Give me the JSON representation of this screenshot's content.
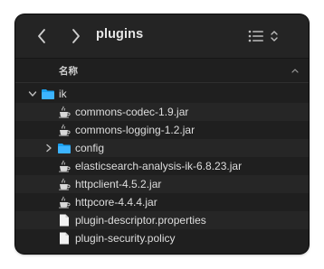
{
  "window": {
    "title": "plugins",
    "view_mode_icon": "list-view-icon"
  },
  "columns": {
    "name_header": "名称"
  },
  "files": [
    {
      "name": "ik",
      "type": "folder",
      "expanded": true,
      "depth": 0,
      "icon": "folder-icon"
    },
    {
      "name": "commons-codec-1.9.jar",
      "type": "jar",
      "depth": 1,
      "icon": "java-jar-icon"
    },
    {
      "name": "commons-logging-1.2.jar",
      "type": "jar",
      "depth": 1,
      "icon": "java-jar-icon"
    },
    {
      "name": "config",
      "type": "folder",
      "expanded": false,
      "depth": 1,
      "icon": "folder-icon"
    },
    {
      "name": "elasticsearch-analysis-ik-6.8.23.jar",
      "type": "jar",
      "depth": 1,
      "icon": "java-jar-icon"
    },
    {
      "name": "httpclient-4.5.2.jar",
      "type": "jar",
      "depth": 1,
      "icon": "java-jar-icon"
    },
    {
      "name": "httpcore-4.4.4.jar",
      "type": "jar",
      "depth": 1,
      "icon": "java-jar-icon"
    },
    {
      "name": "plugin-descriptor.properties",
      "type": "file",
      "depth": 1,
      "icon": "document-icon"
    },
    {
      "name": "plugin-security.policy",
      "type": "file",
      "depth": 1,
      "icon": "document-icon"
    }
  ],
  "colors": {
    "background": "#1f1f1f",
    "folder_blue": "#1aa0f0",
    "text": "#dedede"
  }
}
